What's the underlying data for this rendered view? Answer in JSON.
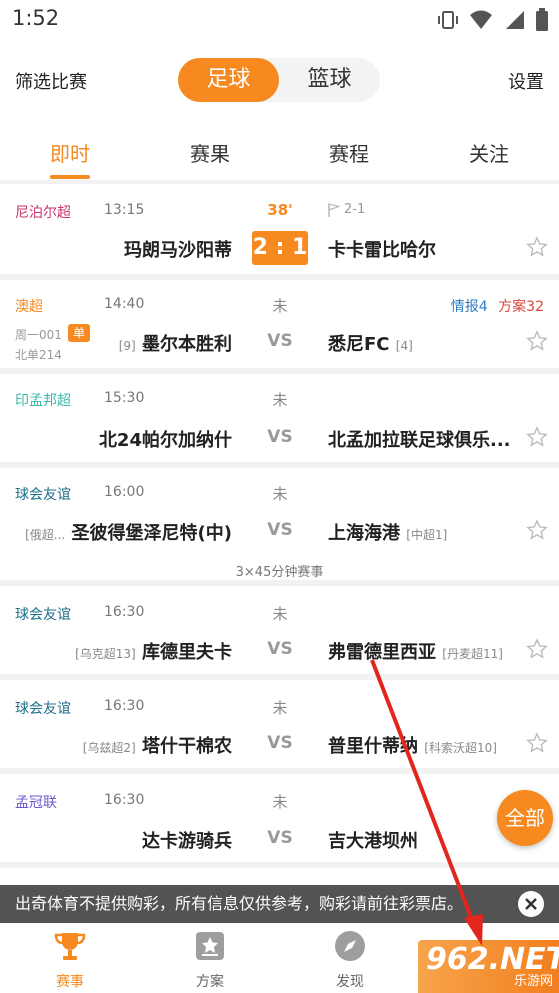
{
  "status_bar": {
    "time": "1:52"
  },
  "header": {
    "filter_label": "筛选比赛",
    "settings_label": "设置",
    "sport_tabs": [
      "足球",
      "篮球"
    ]
  },
  "tabs": [
    "即时",
    "赛果",
    "赛程",
    "关注"
  ],
  "matches": [
    {
      "league": "尼泊尔超",
      "league_color": "#c9356e",
      "time": "13:15",
      "state": "38'",
      "home": "玛朗马沙阳蒂",
      "away": "卡卡雷比哈尔",
      "score": "2 : 1",
      "corner": "2-1"
    },
    {
      "league": "澳超",
      "league_color": "#f6891f",
      "time": "14:40",
      "state": "未",
      "home": "墨尔本胜利",
      "home_rank": "[9]",
      "away": "悉尼FC",
      "away_rank": "[4]",
      "vs": "VS",
      "sub1": "周一001",
      "sub2": "北单214",
      "badge": "单",
      "info1": "情报4",
      "info2": "方案32"
    },
    {
      "league": "印孟邦超",
      "league_color": "#3fb8a8",
      "time": "15:30",
      "state": "未",
      "home": "北24帕尔加纳什",
      "away": "北孟加拉联足球俱乐...",
      "vs": "VS"
    },
    {
      "league": "球会友谊",
      "league_color": "#1f6f8b",
      "time": "16:00",
      "state": "未",
      "home": "圣彼得堡泽尼特(中)",
      "home_rank": "[俄超...",
      "away": "上海海港",
      "away_rank": "[中超1]",
      "vs": "VS",
      "note": "3×45分钟赛事"
    },
    {
      "league": "球会友谊",
      "league_color": "#1f6f8b",
      "time": "16:30",
      "state": "未",
      "home": "库德里夫卡",
      "home_rank": "[乌克超13]",
      "away": "弗雷德里西亚",
      "away_rank": "[丹麦超11]",
      "vs": "VS"
    },
    {
      "league": "球会友谊",
      "league_color": "#1f6f8b",
      "time": "16:30",
      "state": "未",
      "home": "塔什干棉农",
      "home_rank": "[乌兹超2]",
      "away": "普里什蒂纳",
      "away_rank": "[科索沃超10]",
      "vs": "VS"
    },
    {
      "league": "孟冠联",
      "league_color": "#6a5acd",
      "time": "16:30",
      "state": "未",
      "home": "达卡游骑兵",
      "away": "吉大港坝州",
      "vs": "VS"
    }
  ],
  "fab_label": "全部",
  "notice": "出奇体育不提供购彩，所有信息仅供参考，购彩请前往彩票店。",
  "bottom_nav": [
    "赛事",
    "方案",
    "发现"
  ],
  "watermark": {
    "big": "962.NET",
    "small": "乐游网"
  },
  "colors": {
    "accent": "#f6891f"
  }
}
